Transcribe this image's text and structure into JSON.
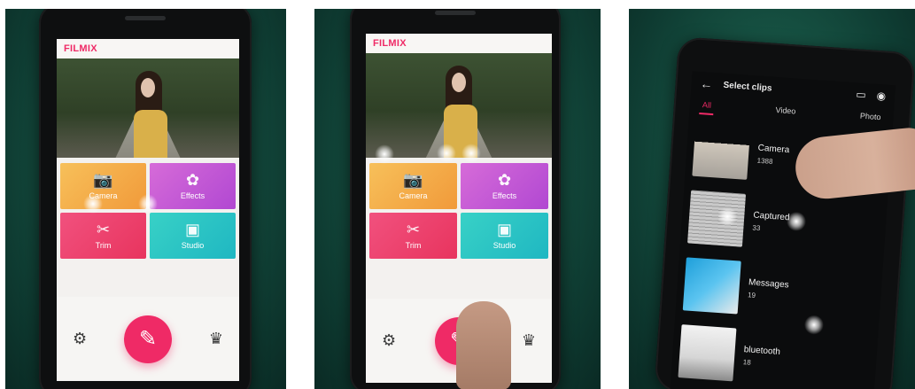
{
  "screens": {
    "home": {
      "logo": "FILMIX",
      "tiles": [
        {
          "label": "Camera"
        },
        {
          "label": "Effects"
        },
        {
          "label": "Trim"
        },
        {
          "label": "Studio"
        }
      ]
    },
    "select_clips": {
      "title": "Select clips",
      "tabs": [
        "All",
        "Video",
        "Photo"
      ],
      "folders": [
        {
          "name": "Camera",
          "count": "1388"
        },
        {
          "name": "Captured",
          "count": "33"
        },
        {
          "name": "Messages",
          "count": "19"
        },
        {
          "name": "bluetooth",
          "count": "18"
        }
      ]
    }
  },
  "colors": {
    "brand_pink": "#ef2a66",
    "camera": "#f4b04b",
    "effects": "#c65bd6",
    "trim": "#ee4270",
    "studio": "#2fc6c4"
  },
  "icons": {
    "settings": "gear-icon",
    "crown": "crown-icon",
    "edit": "edit-icon",
    "back": "back-arrow-icon",
    "video_cam": "video-camera-icon",
    "camera": "camera-icon"
  }
}
